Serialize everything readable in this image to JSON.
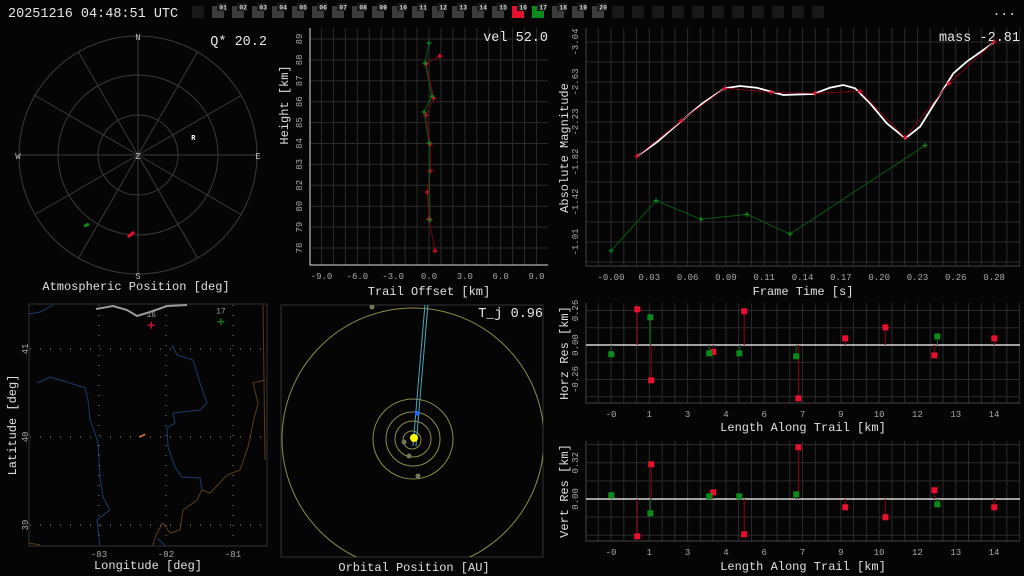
{
  "header": {
    "timestamp": "20251216 04:48:51 UTC",
    "menu_label": "...",
    "frames": [
      {
        "label": "",
        "state": "empty"
      },
      {
        "label": "01",
        "state": "normal"
      },
      {
        "label": "02",
        "state": "normal"
      },
      {
        "label": "03",
        "state": "normal"
      },
      {
        "label": "04",
        "state": "normal"
      },
      {
        "label": "05",
        "state": "normal"
      },
      {
        "label": "06",
        "state": "normal"
      },
      {
        "label": "07",
        "state": "normal"
      },
      {
        "label": "08",
        "state": "normal"
      },
      {
        "label": "09",
        "state": "normal"
      },
      {
        "label": "10",
        "state": "normal"
      },
      {
        "label": "11",
        "state": "normal"
      },
      {
        "label": "12",
        "state": "normal"
      },
      {
        "label": "13",
        "state": "normal"
      },
      {
        "label": "14",
        "state": "normal"
      },
      {
        "label": "15",
        "state": "normal"
      },
      {
        "label": "16",
        "state": "red"
      },
      {
        "label": "17",
        "state": "green"
      },
      {
        "label": "18",
        "state": "normal"
      },
      {
        "label": "19",
        "state": "normal"
      },
      {
        "label": "20",
        "state": "normal"
      },
      {
        "label": "",
        "state": "empty"
      },
      {
        "label": "",
        "state": "empty"
      },
      {
        "label": "",
        "state": "empty"
      },
      {
        "label": "",
        "state": "empty"
      },
      {
        "label": "",
        "state": "empty"
      },
      {
        "label": "",
        "state": "empty"
      },
      {
        "label": "",
        "state": "empty"
      },
      {
        "label": "",
        "state": "empty"
      },
      {
        "label": "",
        "state": "empty"
      },
      {
        "label": "",
        "state": "empty"
      },
      {
        "label": "",
        "state": "empty"
      }
    ]
  },
  "colors": {
    "red": "#e8102f",
    "green": "#0a8a1a",
    "red_dark": "#7a0014",
    "green_dark": "#0a5a12",
    "fit": "#ffffff",
    "empty": "#181818",
    "normal": "#3c3c3c"
  },
  "polar": {
    "title": "Atmospheric Position [deg]",
    "annotation": "Q* 20.2",
    "labels": {
      "n": "N",
      "s": "S",
      "e": "E",
      "w": "W",
      "z": "Z"
    },
    "radiant_label": "R",
    "radiant": {
      "az": 72,
      "alt": 46
    },
    "tracks": [
      {
        "station": "16",
        "color": "red",
        "start": {
          "az": 187,
          "alt": 27.5
        },
        "end": {
          "az": 183,
          "alt": 31.7
        }
      },
      {
        "station": "17",
        "color": "green",
        "start": {
          "az": 217,
          "alt": 22.5
        },
        "end": {
          "az": 215.5,
          "alt": 26
        }
      }
    ]
  },
  "map": {
    "title": "Longitude [deg]",
    "ylabel": "Latitude [deg]",
    "xticks": [
      "-83",
      "-82",
      "-81"
    ],
    "xtick_values": [
      -83,
      -82,
      -81
    ],
    "yticks": [
      "41",
      "40",
      "39"
    ],
    "ytick_values": [
      41,
      40,
      39
    ],
    "stations": [
      {
        "label": "16",
        "color": "red",
        "lon": -82.22,
        "lat": 41.27
      },
      {
        "label": "17",
        "color": "green",
        "lon": -81.18,
        "lat": 41.31
      }
    ],
    "meteor": {
      "start": {
        "lon": -82.4,
        "lat": 40.0
      },
      "end": {
        "lon": -82.31,
        "lat": 40.03
      }
    }
  },
  "orbit": {
    "title": "Orbital Position [AU]",
    "annotation": "T_j 0.96"
  },
  "chart_data": [
    {
      "type": "line",
      "name": "height-vs-offset",
      "annotation": "vel 52.0",
      "xlabel": "Trail Offset [km]",
      "ylabel": "Height [km]",
      "xticks": [
        "-9.0",
        "-6.0",
        "-3.0",
        "0.0",
        "3.0",
        "6.0",
        "9.0"
      ],
      "xtick_values": [
        -9,
        -6,
        -3,
        0,
        3,
        6,
        9
      ],
      "yticks": [
        "89",
        "88",
        "87",
        "86",
        "85",
        "84",
        "83",
        "82",
        "80",
        "79",
        "78"
      ],
      "ytick_range": [
        88.9,
        78.1
      ],
      "series": [
        {
          "name": "16",
          "color": "red",
          "x": [
            0.9,
            -0.25,
            0.4,
            -0.25,
            0.1,
            0.1,
            -0.15,
            0.0,
            0.5
          ],
          "y": [
            88.02,
            87.61,
            85.85,
            84.97,
            83.47,
            82.08,
            80.99,
            79.6,
            77.95
          ]
        },
        {
          "name": "17",
          "color": "green",
          "x": [
            0.0,
            -0.33,
            0.25,
            -0.42,
            0.0,
            0.08
          ],
          "y": [
            88.69,
            87.66,
            85.95,
            85.13,
            83.53,
            79.55
          ]
        }
      ]
    },
    {
      "type": "line",
      "name": "light-curve",
      "annotation": "mass -2.81",
      "xlabel": "Frame Time [s]",
      "ylabel": "Absolute Magnitude",
      "xticks": [
        "-0.00",
        "0.03",
        "0.06",
        "0.09",
        "0.11",
        "0.14",
        "0.17",
        "0.20",
        "0.23",
        "0.26",
        "0.28"
      ],
      "xtick_range": [
        0,
        0.284
      ],
      "yticks": [
        "-3.04",
        "-2.63",
        "-2.23",
        "-1.82",
        "-1.42",
        "-1.01"
      ],
      "ytick_range": [
        -3.04,
        -1.01
      ],
      "series": [
        {
          "name": "16",
          "color": "red",
          "x": [
            0.0193,
            0.0519,
            0.0845,
            0.1186,
            0.1512,
            0.1846,
            0.218,
            0.2505,
            0.2839
          ],
          "y": [
            -1.88,
            -2.24,
            -2.57,
            -2.53,
            -2.52,
            -2.54,
            -2.07,
            -2.62,
            -3.04
          ]
        },
        {
          "name": "17",
          "color": "green",
          "x": [
            0.0,
            0.0334,
            0.0667,
            0.1008,
            0.1327,
            0.2328
          ],
          "y": [
            -0.92,
            -1.43,
            -1.24,
            -1.29,
            -1.09,
            -1.99
          ]
        }
      ],
      "fit": {
        "x": [
          0.0195,
          0.0339,
          0.0519,
          0.0684,
          0.0845,
          0.0956,
          0.108,
          0.1277,
          0.15,
          0.1623,
          0.1722,
          0.1809,
          0.192,
          0.2044,
          0.2182,
          0.2291,
          0.2414,
          0.2538,
          0.2637,
          0.2841
        ],
        "y": [
          -1.883,
          -2.022,
          -2.235,
          -2.424,
          -2.57,
          -2.593,
          -2.576,
          -2.502,
          -2.512,
          -2.576,
          -2.603,
          -2.57,
          -2.418,
          -2.215,
          -2.062,
          -2.18,
          -2.451,
          -2.722,
          -2.84,
          -3.037
        ]
      }
    },
    {
      "type": "scatter",
      "name": "horizontal-residuals",
      "xlabel": "Length Along Trail [km]",
      "ylabel": "Horz Res [km]",
      "xticks": [
        "-0",
        "1",
        "3",
        "4",
        "6",
        "7",
        "9",
        "10",
        "12",
        "13",
        "14"
      ],
      "xtick_range": [
        0,
        14
      ],
      "yticks": [
        "0.26",
        "0.00",
        "-0.26"
      ],
      "ytick_values": [
        0.26,
        0,
        -0.26
      ],
      "series": [
        {
          "name": "16",
          "color": "red",
          "x": [
            0.96,
            1.47,
            3.74,
            4.87,
            6.85,
            8.56,
            10.03,
            11.82,
            14.01
          ],
          "y": [
            0.269,
            -0.266,
            -0.053,
            0.254,
            -0.402,
            0.05,
            0.133,
            -0.078,
            0.05
          ]
        },
        {
          "name": "17",
          "color": "green",
          "x": [
            0.01,
            1.44,
            3.59,
            4.69,
            6.77,
            11.93
          ],
          "y": [
            -0.07,
            0.209,
            -0.063,
            -0.063,
            -0.085,
            0.065
          ]
        }
      ]
    },
    {
      "type": "scatter",
      "name": "vertical-residuals",
      "xlabel": "Length Along Trail [km]",
      "ylabel": "Vert Res [km]",
      "xticks": [
        "-0",
        "1",
        "3",
        "4",
        "6",
        "7",
        "9",
        "10",
        "12",
        "13",
        "14"
      ],
      "xtick_range": [
        0,
        14
      ],
      "yticks": [
        "0.32",
        "0.00"
      ],
      "ytick_values": [
        0.32,
        0
      ],
      "series": [
        {
          "name": "16",
          "color": "red",
          "x": [
            0.96,
            1.47,
            3.74,
            4.87,
            6.85,
            8.56,
            10.03,
            11.82,
            14.01
          ],
          "y": [
            -0.329,
            0.306,
            0.059,
            -0.311,
            0.456,
            -0.073,
            -0.161,
            0.077,
            -0.073
          ]
        },
        {
          "name": "17",
          "color": "green",
          "x": [
            0.01,
            1.44,
            3.59,
            4.69,
            6.77,
            11.93
          ],
          "y": [
            0.033,
            -0.126,
            0.024,
            0.024,
            0.041,
            -0.047
          ]
        }
      ]
    }
  ]
}
